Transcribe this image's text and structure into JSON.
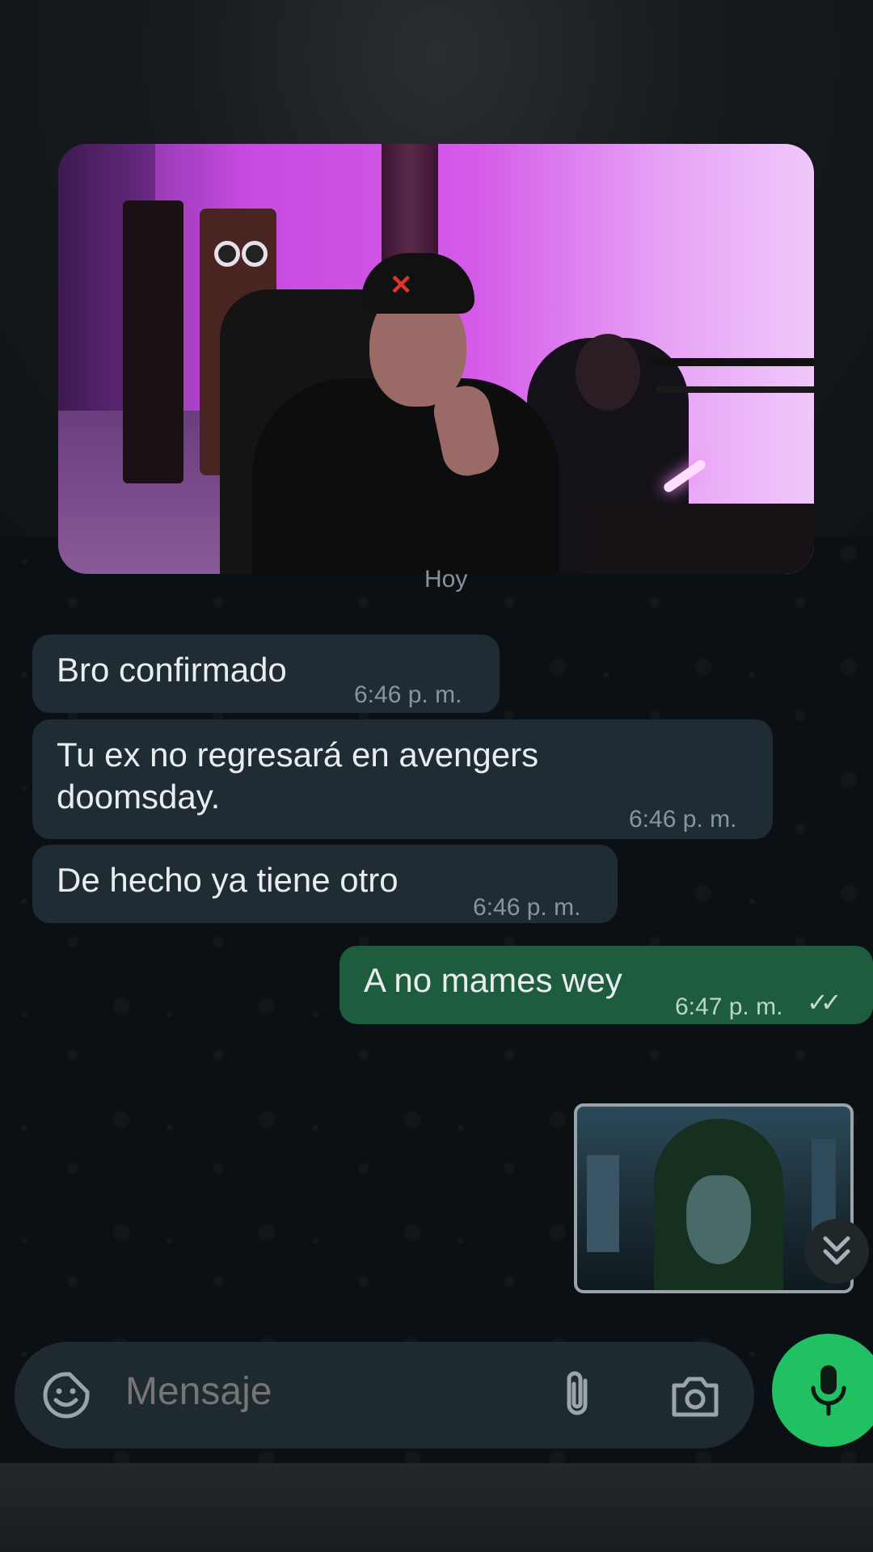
{
  "chat": {
    "date_chip": "Hoy",
    "messages": [
      {
        "text": "Bro confirmado",
        "time": "6:46 p. m.",
        "direction": "incoming"
      },
      {
        "text": "Tu ex no regresará en avengers doomsday.",
        "time": "6:46 p. m.",
        "direction": "incoming"
      },
      {
        "text": "De hecho ya tiene otro",
        "time": "6:46 p. m.",
        "direction": "incoming"
      },
      {
        "text": "A no mames wey",
        "time": "6:47 p. m.",
        "direction": "outgoing",
        "status": "read"
      }
    ],
    "image_message": {
      "description_icon": "image-thumbnail"
    }
  },
  "composer": {
    "placeholder": "Mensaje",
    "icons": [
      "sticker-icon",
      "attach-icon",
      "camera-icon",
      "microphone-icon"
    ]
  },
  "colors": {
    "incoming_bubble": "#1f2c33",
    "outgoing_bubble": "#1d5d3d",
    "mic_button": "#21c063",
    "chat_background": "#0b1014"
  },
  "overlay": {
    "video_feed_icon": "webcam-video"
  }
}
